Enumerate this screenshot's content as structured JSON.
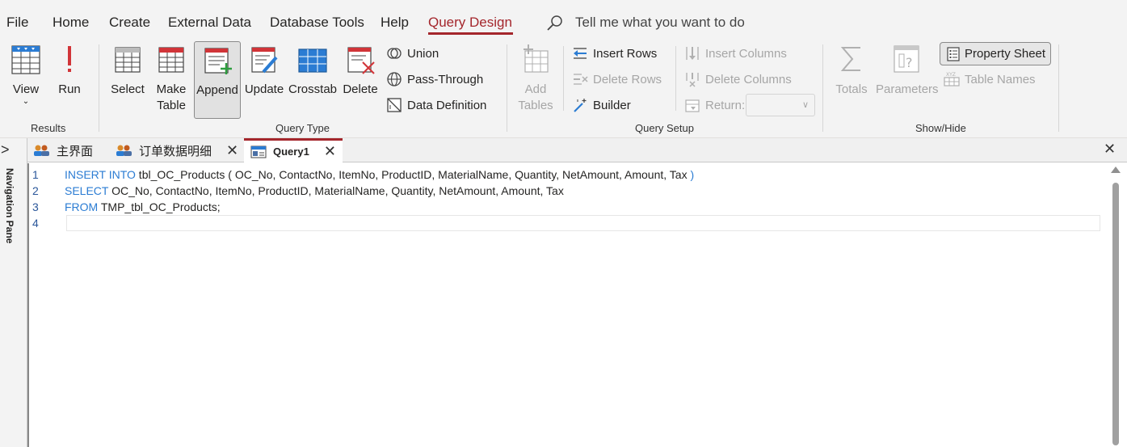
{
  "menu": {
    "file": "File",
    "home": "Home",
    "create": "Create",
    "external_data": "External Data",
    "database_tools": "Database Tools",
    "help": "Help",
    "query_design": "Query Design",
    "tell_me": "Tell me what you want to do"
  },
  "ribbon": {
    "results": {
      "label": "Results",
      "view": "View",
      "run": "Run"
    },
    "query_type": {
      "label": "Query Type",
      "select": "Select",
      "make_table_1": "Make",
      "make_table_2": "Table",
      "append": "Append",
      "update": "Update",
      "crosstab": "Crosstab",
      "delete": "Delete",
      "union": "Union",
      "pass_through": "Pass-Through",
      "data_definition": "Data Definition"
    },
    "query_setup": {
      "label": "Query Setup",
      "add_tables_1": "Add",
      "add_tables_2": "Tables",
      "insert_rows": "Insert Rows",
      "delete_rows": "Delete Rows",
      "builder": "Builder",
      "insert_columns": "Insert Columns",
      "delete_columns": "Delete Columns",
      "return": "Return:",
      "return_value": ""
    },
    "show_hide": {
      "label": "Show/Hide",
      "totals": "Totals",
      "parameters": "Parameters",
      "property_sheet": "Property Sheet",
      "table_names": "Table Names"
    }
  },
  "tabs": [
    {
      "label": "主界面"
    },
    {
      "label": "订单数据明细"
    },
    {
      "label": "Query1"
    }
  ],
  "nav_pane": {
    "label": "Navigation Pane"
  },
  "editor": {
    "lines": [
      {
        "num": "1",
        "kw": "INSERT INTO",
        "text": " tbl_OC_Products ( OC_No, ContactNo, ItemNo, ProductID, MaterialName, Quantity, NetAmount, Amount, Tax ",
        "end": ")"
      },
      {
        "num": "2",
        "kw": "SELECT",
        "text": " OC_No, ContactNo, ItemNo, ProductID, MaterialName, Quantity, NetAmount, Amount, Tax"
      },
      {
        "num": "3",
        "kw": "FROM",
        "text": " TMP_tbl_OC_Products;"
      },
      {
        "num": "4",
        "kw": "",
        "text": ""
      }
    ]
  },
  "colors": {
    "accent": "#a4262c",
    "keyword": "#2b7cd3",
    "ribbon_bg": "#f3f3f3"
  }
}
